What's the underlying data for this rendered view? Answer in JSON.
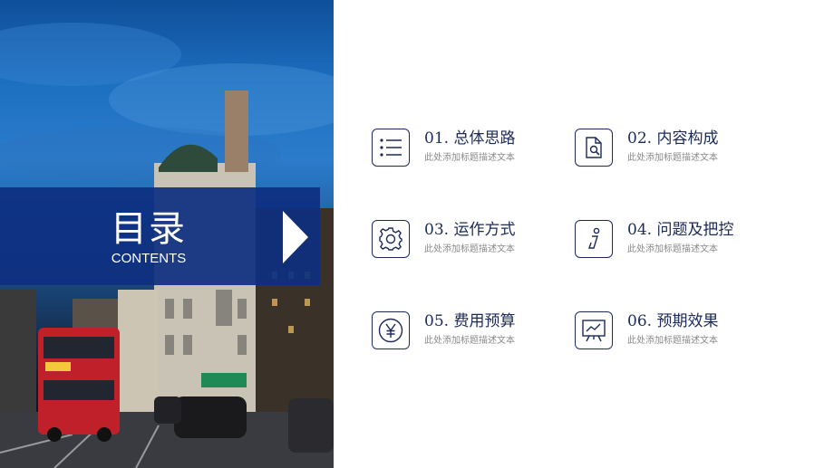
{
  "banner": {
    "title": "目录",
    "subtitle": "CONTENTS"
  },
  "items": [
    {
      "title": "01. 总体思路",
      "desc": "此处添加标题描述文本",
      "icon": "list-icon"
    },
    {
      "title": "02. 内容构成",
      "desc": "此处添加标题描述文本",
      "icon": "document-search-icon"
    },
    {
      "title": "03. 运作方式",
      "desc": "此处添加标题描述文本",
      "icon": "gear-icon"
    },
    {
      "title": "04. 问题及把控",
      "desc": "此处添加标题描述文本",
      "icon": "info-icon"
    },
    {
      "title": "05. 费用预算",
      "desc": "此处添加标题描述文本",
      "icon": "yen-icon"
    },
    {
      "title": "06. 预期效果",
      "desc": "此处添加标题描述文本",
      "icon": "presentation-chart-icon"
    }
  ],
  "colors": {
    "banner": "#0e2f80",
    "accent": "#1b2a58",
    "desc": "#8a8a8a"
  }
}
